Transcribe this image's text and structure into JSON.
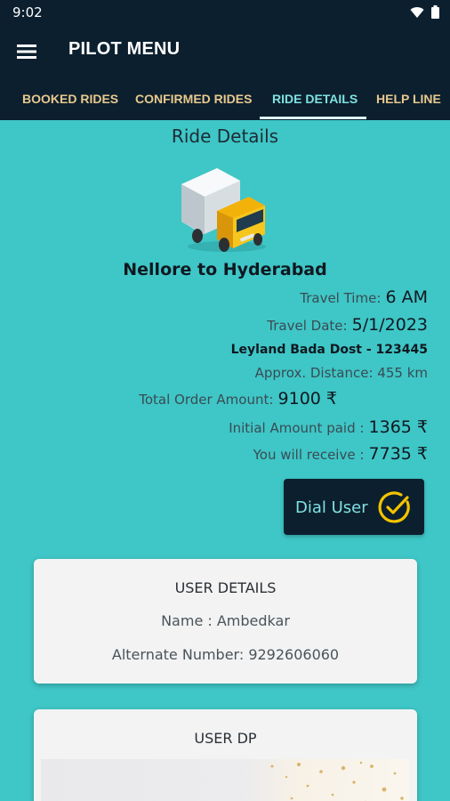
{
  "status_bar": {
    "time": "9:02"
  },
  "app_bar": {
    "title": "PILOT MENU"
  },
  "tabs": [
    {
      "label": "BOOKED RIDES"
    },
    {
      "label": "CONFIRMED RIDES"
    },
    {
      "label": "RIDE DETAILS",
      "active": true
    },
    {
      "label": "HELP LINE"
    }
  ],
  "ride": {
    "section_title": "Ride Details",
    "route": "Nellore to Hyderabad",
    "travel_time_label": "Travel Time:",
    "travel_time_value": "6 AM",
    "travel_date_label": "Travel Date:",
    "travel_date_value": "5/1/2023",
    "vehicle": "Leyland Bada Dost - 123445",
    "distance": "Approx. Distance: 455 km",
    "total_label": "Total Order Amount:",
    "total_value": "9100 ₹",
    "initial_label": "Initial Amount paid :",
    "initial_value": "1365 ₹",
    "receive_label": "You will receive :",
    "receive_value": "7735 ₹"
  },
  "dial_button": {
    "label": "Dial User"
  },
  "user_details": {
    "title": "USER DETAILS",
    "name": "Name : Ambedkar",
    "alternate": "Alternate Number: 9292606060"
  },
  "user_dp": {
    "title": "USER DP"
  },
  "colors": {
    "background": "#3fc6c6",
    "appbar": "#0c1f2e",
    "tab_text": "#e7c98e",
    "tab_active": "#7fe1e1",
    "accent_yellow": "#f3c300"
  }
}
